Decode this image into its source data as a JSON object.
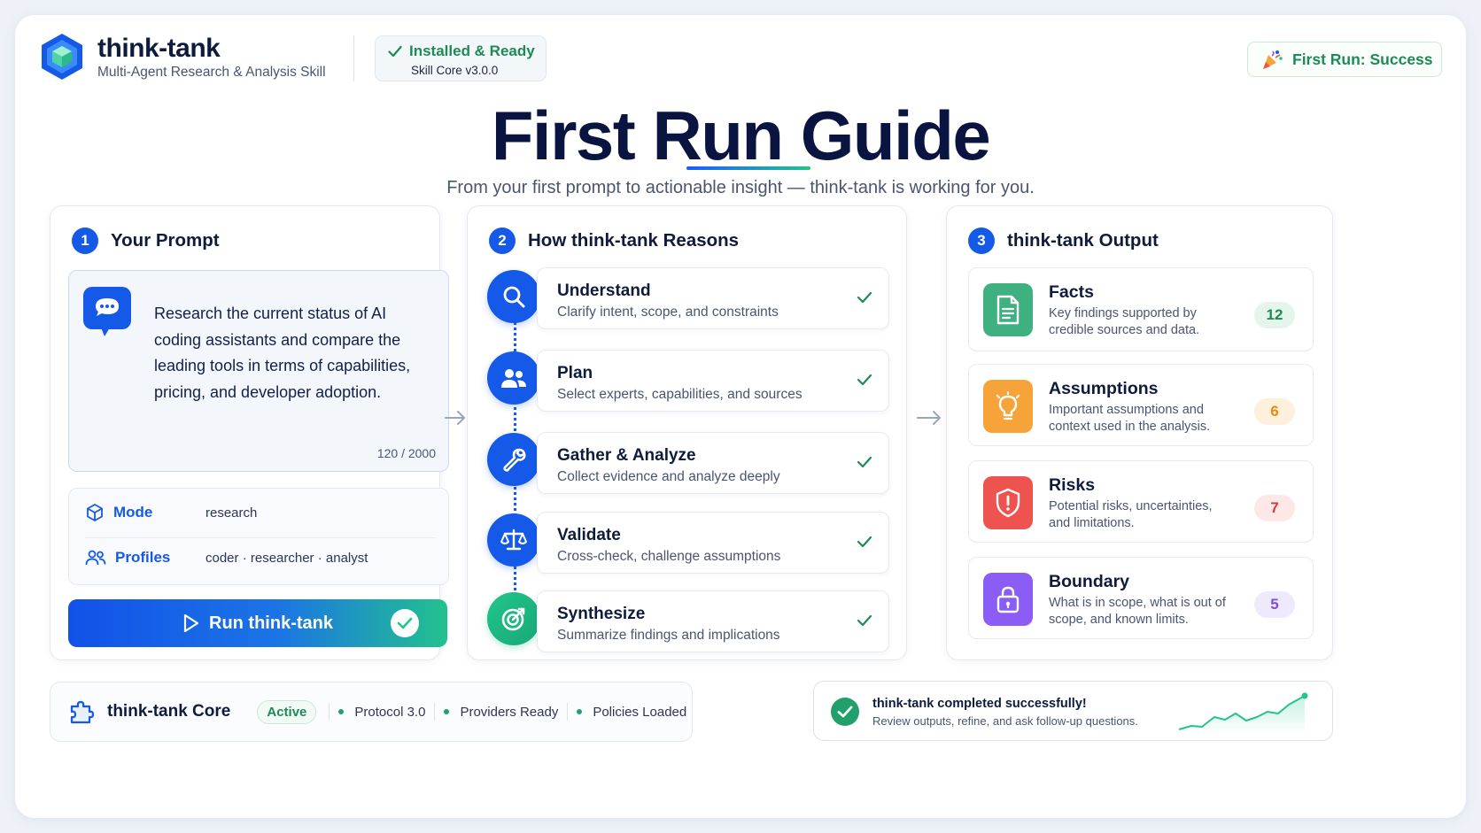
{
  "header": {
    "brand_title": "think-tank",
    "brand_subtitle": "Multi-Agent Research & Analysis Skill",
    "installed_label": "Installed & Ready",
    "installed_version": "Skill Core v3.0.0",
    "first_run_label": "First Run: Success"
  },
  "hero": {
    "title": "First Run Guide",
    "subtitle": "From your first prompt to actionable insight — think-tank is working for you."
  },
  "prompt_card": {
    "number": "1",
    "title": "Your Prompt",
    "prompt_text": "Research the current status of AI coding assistants and compare the leading tools in terms of capabilities, pricing, and developer adoption.",
    "char_count": "120 / 2000",
    "mode_label": "Mode",
    "mode_value": "research",
    "profiles_label": "Profiles",
    "profiles_value": "coder · researcher · analyst",
    "run_button_label": "Run think-tank"
  },
  "reasons_card": {
    "number": "2",
    "title": "How think-tank Reasons",
    "steps": [
      {
        "title": "Understand",
        "desc": "Clarify intent, scope, and constraints",
        "icon": "search-icon"
      },
      {
        "title": "Plan",
        "desc": "Select experts, capabilities, and sources",
        "icon": "users-icon"
      },
      {
        "title": "Gather & Analyze",
        "desc": "Collect evidence and analyze deeply",
        "icon": "wrench-icon"
      },
      {
        "title": "Validate",
        "desc": "Cross-check, challenge assumptions",
        "icon": "scale-icon"
      },
      {
        "title": "Synthesize",
        "desc": "Summarize findings and implications",
        "icon": "target-icon"
      }
    ]
  },
  "output_card": {
    "number": "3",
    "title": "think-tank Output",
    "items": [
      {
        "title": "Facts",
        "desc": "Key findings supported by credible sources and data.",
        "count": "12",
        "icon": "document-icon",
        "color": "#3fb07f"
      },
      {
        "title": "Assumptions",
        "desc": "Important assumptions and context used in the analysis.",
        "count": "6",
        "icon": "lightbulb-icon",
        "color": "#f6a43a"
      },
      {
        "title": "Risks",
        "desc": "Potential risks, uncertainties, and limitations.",
        "count": "7",
        "icon": "shield-alert-icon",
        "color": "#ef5350"
      },
      {
        "title": "Boundary",
        "desc": "What is in scope, what is out of scope, and known limits.",
        "count": "5",
        "icon": "lock-icon",
        "color": "#8b5cf6"
      }
    ]
  },
  "footer": {
    "core_title": "think-tank Core",
    "core_status": "Active",
    "core_items": [
      "Protocol 3.0",
      "Providers Ready",
      "Policies Loaded"
    ],
    "success_title": "think-tank completed successfully!",
    "success_subtitle": "Review outputs, refine, and ask follow-up questions."
  },
  "colors": {
    "primary": "#1559e8",
    "success": "#1e8a55",
    "accent_green": "#22c58b"
  }
}
